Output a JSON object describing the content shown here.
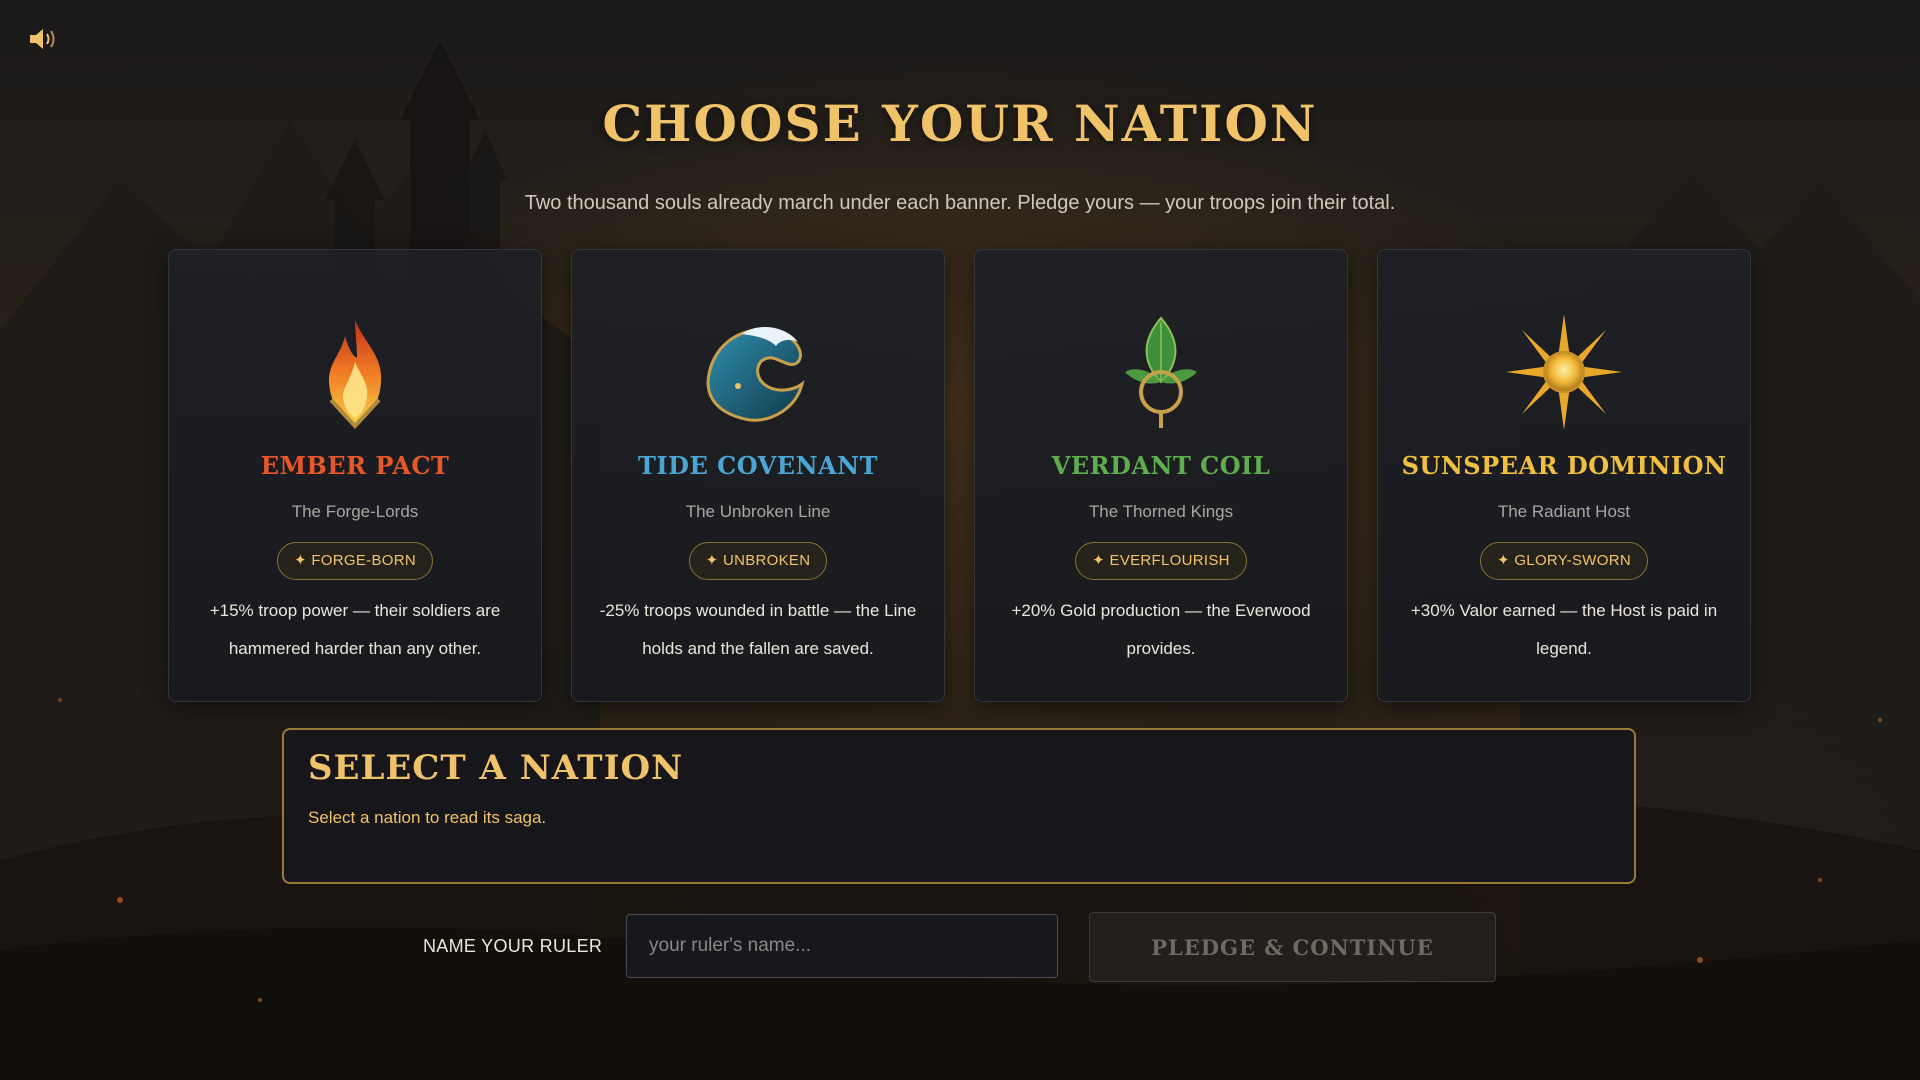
{
  "page": {
    "title": "CHOOSE YOUR NATION",
    "subtitle": "Two thousand souls already march under each banner. Pledge yours — your troops join their total."
  },
  "sound_toggle": {
    "icon": "speaker-icon"
  },
  "nations": [
    {
      "name": "EMBER PACT",
      "epithet": "The Forge-Lords",
      "badge": "✦ FORGE-BORN",
      "description": "+15% troop power — their soldiers are hammered harder than any other.",
      "color": "#e8572a",
      "icon": "flame-emblem-icon"
    },
    {
      "name": "TIDE COVENANT",
      "epithet": "The Unbroken Line",
      "badge": "✦ UNBROKEN",
      "description": "-25% troops wounded in battle — the Line holds and the fallen are saved.",
      "color": "#4aa6d4",
      "icon": "wave-emblem-icon"
    },
    {
      "name": "VERDANT COIL",
      "epithet": "The Thorned Kings",
      "badge": "✦ EVERFLOURISH",
      "description": "+20% Gold production — the Everwood provides.",
      "color": "#5fae4e",
      "icon": "leaf-emblem-icon"
    },
    {
      "name": "SUNSPEAR DOMINION",
      "epithet": "The Radiant Host",
      "badge": "✦ GLORY-SWORN",
      "description": "+30% Valor earned — the Host is paid in legend.",
      "color": "#f0c040",
      "icon": "sun-emblem-icon"
    }
  ],
  "details": {
    "title": "SELECT A NATION",
    "text": "Select a nation to read its saga."
  },
  "ruler": {
    "label": "NAME YOUR RULER",
    "placeholder": "your ruler's name...",
    "value": ""
  },
  "pledge_button": {
    "label": "PLEDGE & CONTINUE",
    "enabled": false
  },
  "colors": {
    "accent": "#f0c36a",
    "panel_border": "#9a7a38"
  }
}
